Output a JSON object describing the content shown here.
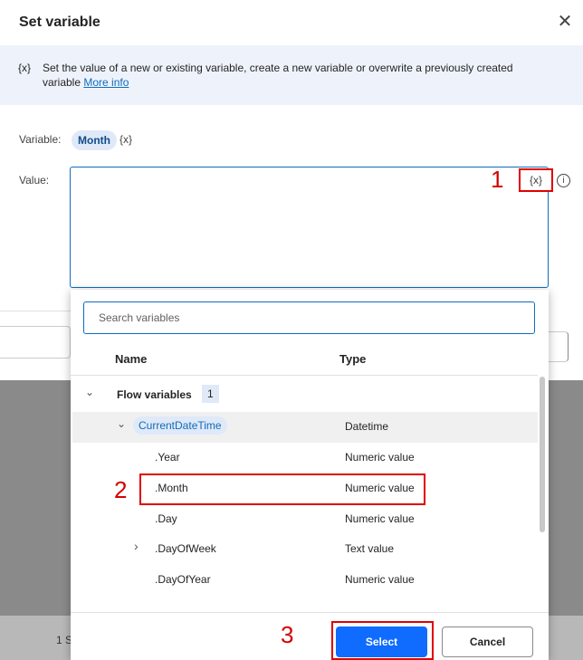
{
  "dialog": {
    "title": "Set variable",
    "close_icon": "close-icon",
    "info_icon_text": "{x}",
    "info_text": "Set the value of a new or existing variable, create a new variable or overwrite a previously created variable",
    "info_link": "More info"
  },
  "variable": {
    "label": "Variable:",
    "name": "Month",
    "icon_text": "{x}"
  },
  "value": {
    "label": "Value:",
    "picker_text": "{x}",
    "info_symbol": "i"
  },
  "steps": {
    "one": "1",
    "two": "2",
    "three": "3"
  },
  "picker": {
    "search_placeholder": "Search variables",
    "columns": {
      "name": "Name",
      "type": "Type"
    },
    "group": {
      "label": "Flow variables",
      "count": "1"
    },
    "rows": [
      {
        "name": "CurrentDateTime",
        "type": "Datetime"
      },
      {
        "name": ".Year",
        "type": "Numeric value"
      },
      {
        "name": ".Month",
        "type": "Numeric value"
      },
      {
        "name": ".Day",
        "type": "Numeric value"
      },
      {
        "name": ".DayOfWeek",
        "type": "Text value"
      },
      {
        "name": ".DayOfYear",
        "type": "Numeric value"
      }
    ],
    "select_label": "Select",
    "cancel_label": "Cancel"
  },
  "background": {
    "footer_text": "1 S"
  },
  "colors": {
    "accent": "#0f6cbd",
    "primary_button": "#0f6cff",
    "annotation_red": "#e00000"
  }
}
